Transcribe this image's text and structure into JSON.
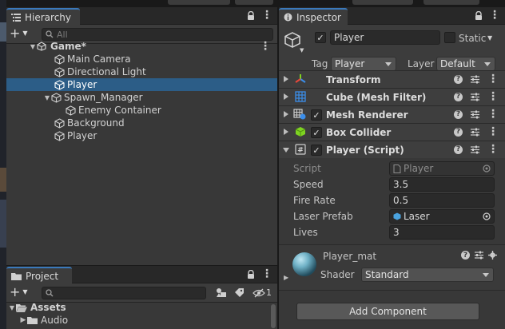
{
  "hierarchy": {
    "tab_label": "Hierarchy",
    "add_label": "+",
    "search_placeholder": "All",
    "items": [
      {
        "label": "Game*",
        "depth": 0,
        "expanded": true,
        "type": "scene"
      },
      {
        "label": "Main Camera",
        "depth": 1,
        "type": "object"
      },
      {
        "label": "Directional Light",
        "depth": 1,
        "type": "object"
      },
      {
        "label": "Player",
        "depth": 1,
        "type": "object",
        "selected": true
      },
      {
        "label": "Spawn_Manager",
        "depth": 1,
        "expanded": true,
        "type": "object"
      },
      {
        "label": "Enemy Container",
        "depth": 2,
        "type": "object"
      },
      {
        "label": "Background",
        "depth": 1,
        "type": "object"
      },
      {
        "label": "Player",
        "depth": 1,
        "type": "object"
      }
    ]
  },
  "project": {
    "tab_label": "Project",
    "add_label": "+",
    "hidden_count": "1",
    "items": [
      {
        "label": "Assets",
        "depth": 0,
        "expanded": true
      },
      {
        "label": "Audio",
        "depth": 1
      }
    ]
  },
  "inspector": {
    "tab_label": "Inspector",
    "object_name": "Player",
    "active": true,
    "static_label": "Static",
    "static_checked": false,
    "tag_label": "Tag",
    "tag_value": "Player",
    "layer_label": "Layer",
    "layer_value": "Default",
    "components": [
      {
        "name": "Transform",
        "icon": "transform-icon",
        "has_checkbox": false,
        "expanded": false
      },
      {
        "name": "Cube (Mesh Filter)",
        "icon": "grid-icon",
        "has_checkbox": false,
        "expanded": false
      },
      {
        "name": "Mesh Renderer",
        "icon": "mesh-renderer-icon",
        "has_checkbox": true,
        "checked": true,
        "expanded": false
      },
      {
        "name": "Box Collider",
        "icon": "box-collider-icon",
        "has_checkbox": true,
        "checked": true,
        "expanded": false
      },
      {
        "name": "Player (Script)",
        "icon": "script-icon",
        "has_checkbox": true,
        "checked": true,
        "expanded": true
      }
    ],
    "script_props": {
      "script_label": "Script",
      "script_value": "Player",
      "speed_label": "Speed",
      "speed_value": "3.5",
      "fire_rate_label": "Fire Rate",
      "fire_rate_value": "0.5",
      "laser_prefab_label": "Laser Prefab",
      "laser_prefab_value": "Laser",
      "lives_label": "Lives",
      "lives_value": "3"
    },
    "material": {
      "name": "Player_mat",
      "shader_label": "Shader",
      "shader_value": "Standard"
    },
    "add_component_label": "Add Component"
  },
  "colors": {
    "selection": "#2c5d87",
    "accent_tab": "#3a79bb",
    "panel_bg": "#383838",
    "collider_green": "#7ed321"
  }
}
